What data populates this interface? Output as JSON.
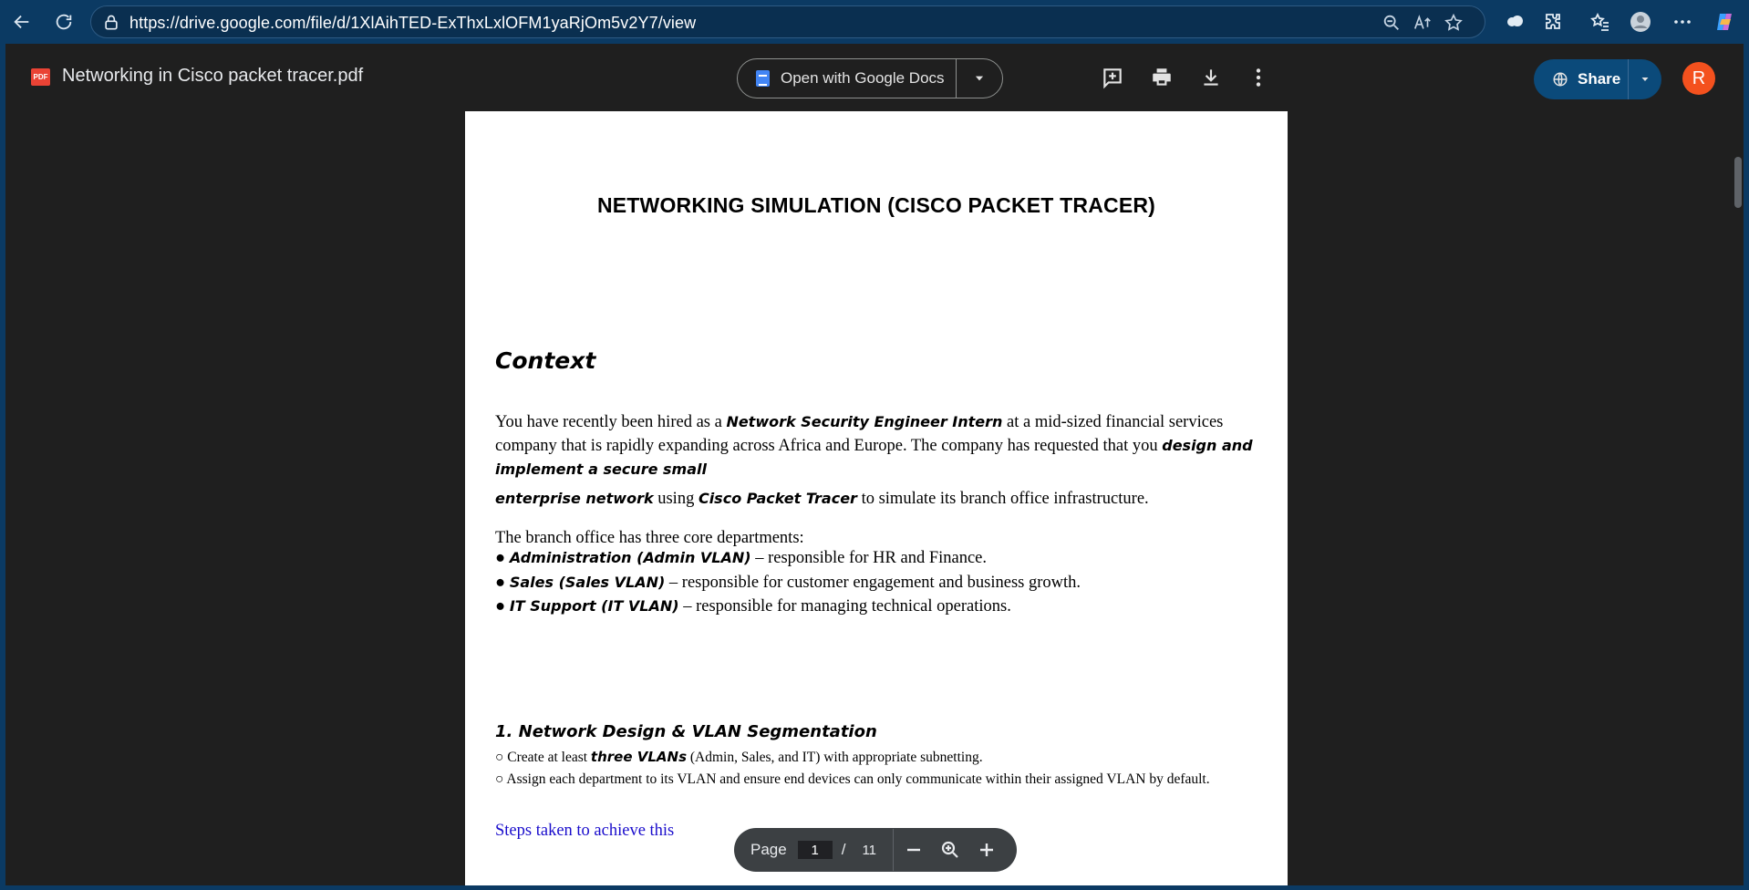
{
  "browser": {
    "url": "https://drive.google.com/file/d/1XlAihTED-ExThxLxlOFM1yaRjOm5v2Y7/view"
  },
  "drive": {
    "file_badge": "PDF",
    "file_name": "Networking in Cisco packet tracer.pdf",
    "open_with_label": "Open with Google Docs",
    "share_label": "Share",
    "avatar_initial": "R"
  },
  "document": {
    "title": "NETWORKING SIMULATION (CISCO PACKET TRACER)",
    "context_heading": "Context",
    "para1": {
      "t1": "You have recently been hired as a ",
      "b1": "Network Security Engineer Intern",
      "t2": " at a mid-sized financial services company that is rapidly expanding across Africa and Europe. The company has requested that you ",
      "b2": "design and implement a secure small"
    },
    "para1b": {
      "b1": "enterprise network",
      "t1": " using ",
      "b2": "Cisco Packet Tracer",
      "t2": " to simulate its branch office infrastructure."
    },
    "branch_intro": "The branch office has three core departments:",
    "departments": [
      {
        "bullet": "●",
        "name": "Administration (Admin VLAN)",
        "desc": " – responsible for HR and Finance."
      },
      {
        "bullet": "●",
        "name": "Sales (Sales VLAN)",
        "desc": " – responsible for customer engagement and business growth."
      },
      {
        "bullet": "●",
        "name": "IT Support (IT VLAN)",
        "desc": " – responsible for managing technical operations."
      }
    ],
    "section1": {
      "heading": "1. Network Design & VLAN Segmentation",
      "bullet1": {
        "mark": "○",
        "t1": " Create at least ",
        "b1": "three VLANs",
        "t2": " (Admin, Sales, and IT) with appropriate subnetting."
      },
      "bullet2": {
        "mark": "○",
        "text": " Assign each department to its VLAN and ensure end devices can only communicate within their assigned VLAN by default."
      }
    },
    "steps_link": "Steps taken to achieve this"
  },
  "page_nav": {
    "label": "Page",
    "current": "1",
    "slash": "/",
    "total": "11"
  }
}
